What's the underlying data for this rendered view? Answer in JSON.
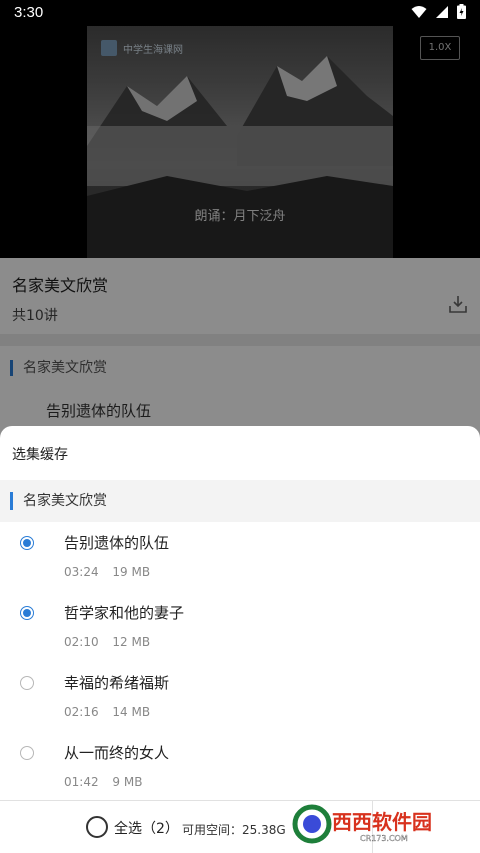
{
  "status_bar": {
    "time": "3:30"
  },
  "player": {
    "logo_text": "中学生海课网",
    "caption": "朗诵：月下泛舟",
    "speed": "1.0X"
  },
  "course": {
    "title": "名家美文欣赏",
    "count": "共10讲"
  },
  "background_list": {
    "section_title": "名家美文欣赏",
    "first_item": "告别遗体的队伍"
  },
  "sheet": {
    "title": "选集缓存",
    "section_title": "名家美文欣赏",
    "episodes": [
      {
        "name": "告别遗体的队伍",
        "duration": "03:24",
        "size": "19 MB",
        "selected": true
      },
      {
        "name": "哲学家和他的妻子",
        "duration": "02:10",
        "size": "12 MB",
        "selected": true
      },
      {
        "name": "幸福的希绪福斯",
        "duration": "02:16",
        "size": "14 MB",
        "selected": false
      },
      {
        "name": "从一而终的女人",
        "duration": "01:42",
        "size": "9 MB",
        "selected": false
      }
    ],
    "footer": {
      "select_all": "全选（2）",
      "space": "可用空间：25.38G"
    }
  },
  "watermark": {
    "text_main": "西西软件园",
    "text_sub": "CR173.COM"
  },
  "colors": {
    "accent": "#2a7cd6"
  }
}
